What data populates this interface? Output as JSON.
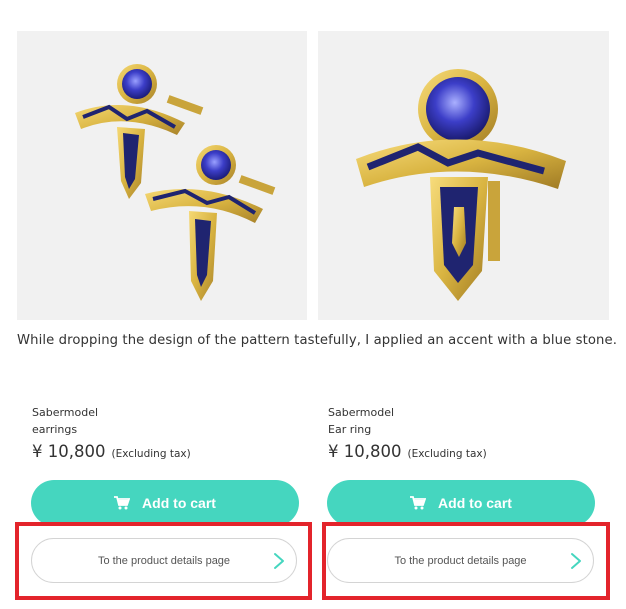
{
  "images": [
    {
      "alt": "Sabermodel earrings pair photo"
    },
    {
      "alt": "Sabermodel ear ring close-up photo"
    }
  ],
  "description": "While dropping the design of the pattern tastefully, I applied an accent with a blue stone.",
  "products": [
    {
      "brand": "Sabermodel",
      "name": "earrings",
      "price": "¥ 10,800",
      "tax_note": "(Excluding tax)",
      "cart_label": "Add to cart",
      "details_label": "To the product details page"
    },
    {
      "brand": "Sabermodel",
      "name": "Ear ring",
      "price": "¥ 10,800",
      "tax_note": "(Excluding tax)",
      "cart_label": "Add to cart",
      "details_label": "To the product details page"
    }
  ],
  "colors": {
    "accent": "#45d6bf",
    "highlight": "#e3242b",
    "gold": "#d9b441",
    "stone": "#3c3ec8",
    "enamel": "#1f2470",
    "photo_bg": "#f1f1f1"
  }
}
